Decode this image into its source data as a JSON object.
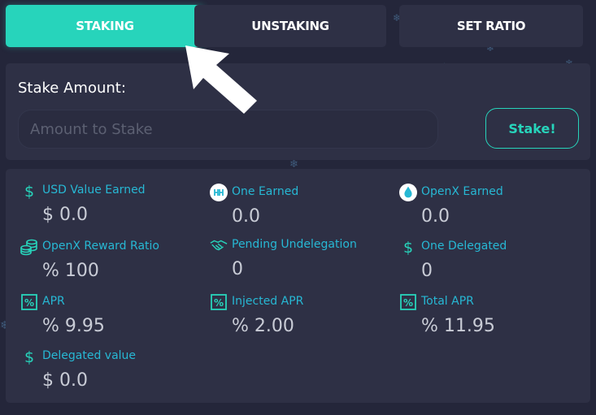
{
  "tabs": [
    {
      "label": "STAKING",
      "active": true
    },
    {
      "label": "UNSTAKING",
      "active": false
    },
    {
      "label": "SET RATIO",
      "active": false
    }
  ],
  "stake": {
    "title": "Stake Amount:",
    "placeholder": "Amount to Stake",
    "value": "",
    "button_label": "Stake!"
  },
  "stats": {
    "usd_value_earned": {
      "label": "USD Value Earned",
      "value": "$ 0.0",
      "icon": "dollar-icon"
    },
    "one_earned": {
      "label": "One Earned",
      "value": "0.0",
      "icon": "harmony-one-icon"
    },
    "openx_earned": {
      "label": "OpenX Earned",
      "value": "0.0",
      "icon": "openx-drop-icon"
    },
    "openx_reward_ratio": {
      "label": "OpenX Reward Ratio",
      "value": "% 100",
      "icon": "coins-icon"
    },
    "pending_undelegation": {
      "label": "Pending Undelegation",
      "value": "0",
      "icon": "handshake-icon"
    },
    "one_delegated": {
      "label": "One Delegated",
      "value": "0",
      "icon": "dollar-icon"
    },
    "apr": {
      "label": "APR",
      "value": "% 9.95",
      "icon": "percent-icon"
    },
    "injected_apr": {
      "label": "Injected APR",
      "value": "% 2.00",
      "icon": "percent-icon"
    },
    "total_apr": {
      "label": "Total APR",
      "value": "% 11.95",
      "icon": "percent-icon"
    },
    "delegated_value": {
      "label": "Delegated value",
      "value": "$ 0.0",
      "icon": "dollar-icon"
    }
  },
  "colors": {
    "accent": "#27d4bb",
    "label": "#27b8d4",
    "background": "#24263a",
    "panel": "#2e3045"
  }
}
